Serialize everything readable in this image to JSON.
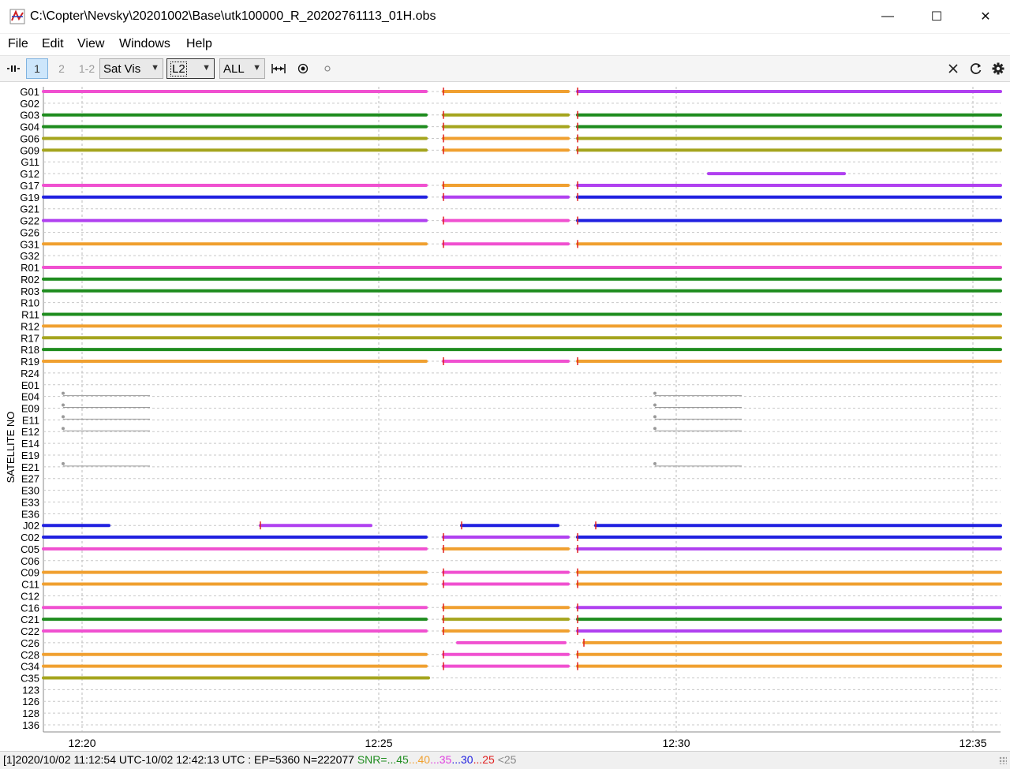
{
  "window": {
    "title": "C:\\Copter\\Nevsky\\20201002\\Base\\utk100000_R_20202761113_01H.obs",
    "controls": {
      "minimize": "—",
      "maximize": "☐",
      "close": "✕"
    }
  },
  "menu": [
    {
      "label": "File"
    },
    {
      "label": "Edit"
    },
    {
      "label": "View"
    },
    {
      "label": "Windows"
    },
    {
      "label": "Help"
    }
  ],
  "toolbar": {
    "pause_icon": "pause-icon",
    "btn1": "1",
    "btn2": "2",
    "btn12": "1-2",
    "plot_type": "Sat Vis",
    "freq": "L2",
    "sat_sys": "ALL",
    "fit_icon": "fit-horizontal-icon",
    "center_icon": "center-icon",
    "dot_icon": "dot-icon",
    "close_icon": "close-icon",
    "reload_icon": "reload-icon",
    "settings_icon": "gear-icon"
  },
  "chart_data": {
    "type": "scatter",
    "ylabel": "SATELLITE NO",
    "xlabel": "",
    "x_ticks": [
      "12:20",
      "12:25",
      "12:30",
      "12:35"
    ],
    "satellites": [
      {
        "id": "G01",
        "color": "mag"
      },
      {
        "id": "G02"
      },
      {
        "id": "G03",
        "color": "green"
      },
      {
        "id": "G04",
        "color": "green"
      },
      {
        "id": "G06",
        "color": "olive"
      },
      {
        "id": "G09",
        "color": "olive"
      },
      {
        "id": "G11"
      },
      {
        "id": "G12",
        "color": "mix"
      },
      {
        "id": "G17",
        "color": "mag"
      },
      {
        "id": "G19",
        "color": "blue"
      },
      {
        "id": "G21"
      },
      {
        "id": "G22",
        "color": "purple"
      },
      {
        "id": "G26"
      },
      {
        "id": "G31",
        "color": "orange"
      },
      {
        "id": "G32"
      },
      {
        "id": "R01",
        "color": "mag"
      },
      {
        "id": "R02",
        "color": "green"
      },
      {
        "id": "R03",
        "color": "green"
      },
      {
        "id": "R10"
      },
      {
        "id": "R11",
        "color": "green"
      },
      {
        "id": "R12",
        "color": "orange"
      },
      {
        "id": "R17",
        "color": "olive"
      },
      {
        "id": "R18",
        "color": "green"
      },
      {
        "id": "R19",
        "color": "orange"
      },
      {
        "id": "R24"
      },
      {
        "id": "E01"
      },
      {
        "id": "E04"
      },
      {
        "id": "E09"
      },
      {
        "id": "E11"
      },
      {
        "id": "E12"
      },
      {
        "id": "E14"
      },
      {
        "id": "E19"
      },
      {
        "id": "E21"
      },
      {
        "id": "E27"
      },
      {
        "id": "E30"
      },
      {
        "id": "E33"
      },
      {
        "id": "E36"
      },
      {
        "id": "J02",
        "color": "blue"
      },
      {
        "id": "C02",
        "color": "blue"
      },
      {
        "id": "C05",
        "color": "mag"
      },
      {
        "id": "C06"
      },
      {
        "id": "C09",
        "color": "orange"
      },
      {
        "id": "C11",
        "color": "orange"
      },
      {
        "id": "C12"
      },
      {
        "id": "C16",
        "color": "mag"
      },
      {
        "id": "C21",
        "color": "green"
      },
      {
        "id": "C22",
        "color": "mag"
      },
      {
        "id": "C26",
        "color": "mag"
      },
      {
        "id": "C28",
        "color": "orange"
      },
      {
        "id": "C34",
        "color": "orange"
      },
      {
        "id": "C35",
        "color": "olive"
      },
      {
        "id": "123"
      },
      {
        "id": "126"
      },
      {
        "id": "128"
      },
      {
        "id": "136"
      }
    ],
    "snr_palette": {
      "green": "#1e8c1e",
      "olive": "#a5a51e",
      "orange": "#f0a030",
      "mag": "#f050d0",
      "purple": "#b040f0",
      "blue": "#2020e0",
      "red": "#e02020",
      "gray": "#999999"
    }
  },
  "status": {
    "prefix": "[1]2020/10/02 11:12:54 UTC-10/02 12:42:13 UTC : EP=5360 N=222077 ",
    "snr_label": "SNR=...",
    "s45": "45",
    "s40": "...40",
    "s35": "...35",
    "s30": "...30",
    "s25": "...25",
    "slt25": " <25",
    "colors": {
      "green": "#1e8c1e",
      "orange": "#f0a030",
      "magenta": "#e040e0",
      "blue": "#2020e0",
      "red": "#e02020",
      "gray": "#888888"
    }
  }
}
